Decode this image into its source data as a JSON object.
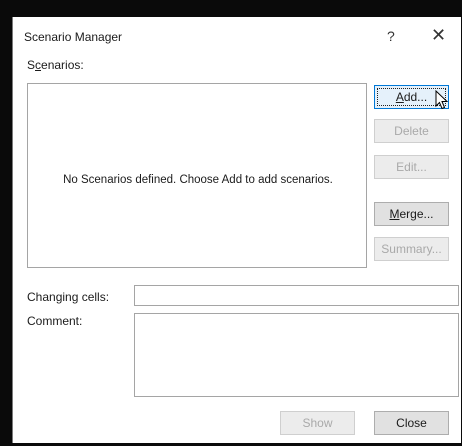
{
  "dialog": {
    "title": "Scenario Manager",
    "help_glyph": "?",
    "close_glyph": "✕"
  },
  "scenarios": {
    "label_prefix": "S",
    "label_underlined": "c",
    "label_suffix": "enarios:",
    "empty_message": "No Scenarios defined. Choose Add to add scenarios."
  },
  "buttons": {
    "add_u": "A",
    "add_rest": "dd...",
    "delete": "Delete",
    "edit": "Edit...",
    "merge_u": "M",
    "merge_rest": "erge...",
    "summary": "Summary...",
    "show": "Show",
    "close": "Close"
  },
  "fields": {
    "changing_cells_label": "Changing cells:",
    "changing_cells_value": "",
    "comment_label": "Comment:",
    "comment_value": ""
  }
}
